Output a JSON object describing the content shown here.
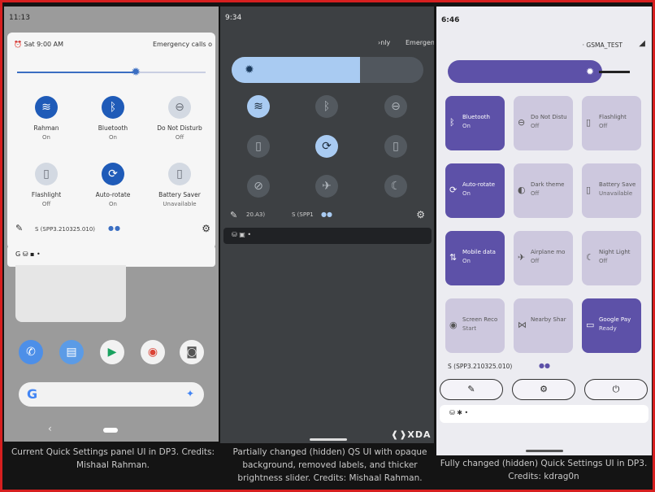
{
  "panel1": {
    "time": "11:13",
    "alarm": "Sat 9:00 AM",
    "emergency": "Emergency calls o",
    "brightness_level": 0.63,
    "tiles": [
      {
        "label": "Rahman",
        "state": "On",
        "icon": "wifi-icon",
        "glyph": "≋",
        "active": true
      },
      {
        "label": "Bluetooth",
        "state": "On",
        "icon": "bluetooth-icon",
        "glyph": "ᛒ",
        "active": true
      },
      {
        "label": "Do Not Disturb",
        "state": "Off",
        "icon": "do-not-disturb-icon",
        "glyph": "⊖",
        "active": false
      },
      {
        "label": "Flashlight",
        "state": "Off",
        "icon": "flashlight-icon",
        "glyph": "▯",
        "active": false
      },
      {
        "label": "Auto-rotate",
        "state": "On",
        "icon": "auto-rotate-icon",
        "glyph": "⟳",
        "active": true
      },
      {
        "label": "Battery Saver",
        "state": "Unavailable",
        "icon": "battery-saver-icon",
        "glyph": "▯",
        "active": false
      }
    ],
    "build": "S (SPP3.210325.010)",
    "notif_icons": "G  ⛁  ▪  •",
    "caption": "Current Quick Settings panel UI in DP3. Credits: Mishaal Rahman."
  },
  "panel2": {
    "time": "9:34",
    "header_left": "›nly",
    "header_right": "Emergen",
    "brightness_level": 0.67,
    "tiles": [
      {
        "icon": "wifi-icon",
        "glyph": "≋",
        "active": true
      },
      {
        "icon": "bluetooth-icon",
        "glyph": "ᛒ",
        "active": false
      },
      {
        "icon": "do-not-disturb-icon",
        "glyph": "⊖",
        "active": false
      },
      {
        "icon": "flashlight-icon",
        "glyph": "▯",
        "active": false
      },
      {
        "icon": "auto-rotate-icon",
        "glyph": "⟳",
        "active": true
      },
      {
        "icon": "battery-saver-icon",
        "glyph": "▯",
        "active": false
      },
      {
        "icon": "mobile-data-off-icon",
        "glyph": "⊘",
        "active": false
      },
      {
        "icon": "airplane-icon",
        "glyph": "✈",
        "active": false
      },
      {
        "icon": "night-light-icon",
        "glyph": "☾",
        "active": false
      }
    ],
    "build_a": "20.A3)",
    "build_b": "S (SPP1",
    "notif_icons": "⛁  ▣  •",
    "watermark": "❰❱XDA",
    "caption": "Partially changed (hidden) QS UI with opaque background, removed labels, and thicker brightness slider. Credits: Mishaal Rahman."
  },
  "panel3": {
    "time": "6:46",
    "carrier": "· GSMA_TEST",
    "tiles": [
      {
        "label": "Bluetooth",
        "state": "On",
        "icon": "bluetooth-icon",
        "glyph": "ᛒ",
        "active": true
      },
      {
        "label": "Do Not Distu",
        "state": "Off",
        "icon": "do-not-disturb-icon",
        "glyph": "⊖",
        "active": false
      },
      {
        "label": "Flashlight",
        "state": "Off",
        "icon": "flashlight-icon",
        "glyph": "▯",
        "active": false
      },
      {
        "label": "Auto-rotate",
        "state": "On",
        "icon": "auto-rotate-icon",
        "glyph": "⟳",
        "active": true
      },
      {
        "label": "Dark theme",
        "state": "Off",
        "icon": "dark-theme-icon",
        "glyph": "◐",
        "active": false
      },
      {
        "label": "Battery Save",
        "state": "Unavailable",
        "icon": "battery-saver-icon",
        "glyph": "▯",
        "active": false
      },
      {
        "label": "Mobile data",
        "state": "On",
        "icon": "mobile-data-icon",
        "glyph": "⇅",
        "active": true
      },
      {
        "label": "Airplane mo",
        "state": "Off",
        "icon": "airplane-icon",
        "glyph": "✈",
        "active": false
      },
      {
        "label": "Night Light",
        "state": "Off",
        "icon": "night-light-icon",
        "glyph": "☾",
        "active": false
      },
      {
        "label": "Screen Reco",
        "state": "Start",
        "icon": "screen-record-icon",
        "glyph": "◉",
        "active": false
      },
      {
        "label": "Nearby Shar",
        "state": "",
        "icon": "nearby-share-icon",
        "glyph": "⋈",
        "active": false
      },
      {
        "label": "Google Pay",
        "state": "Ready",
        "icon": "google-pay-icon",
        "glyph": "▭",
        "active": true
      }
    ],
    "build": "S (SPP3.210325.010)",
    "buttons": [
      {
        "name": "edit-button",
        "icon": "pencil-icon",
        "glyph": "✎"
      },
      {
        "name": "settings-button",
        "icon": "gear-icon",
        "glyph": "⚙"
      },
      {
        "name": "power-button",
        "icon": "power-icon",
        "glyph": "⏻"
      }
    ],
    "notif_icons": "⛁  ✱  •",
    "caption": "Fully changed (hidden) Quick Settings UI in DP3. Credits: kdrag0n"
  },
  "colors": {
    "p1_accent": "#1f5bb8",
    "p2_accent": "#a9cbf2",
    "p3_accent": "#5d51a8",
    "frame": "#d61f1f"
  }
}
